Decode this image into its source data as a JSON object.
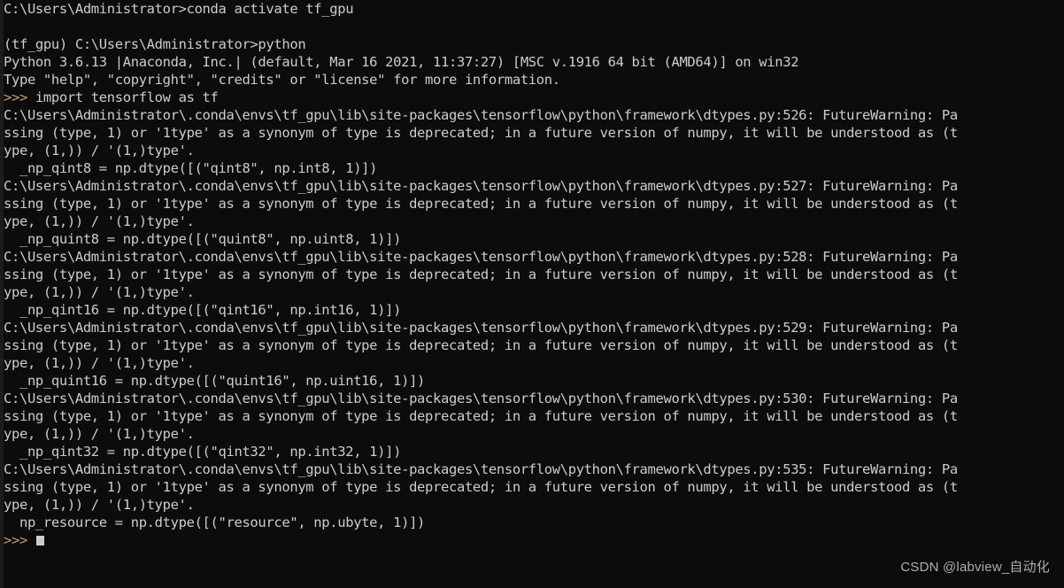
{
  "terminal": {
    "background_color": "#0c0c0c",
    "foreground_color": "#cccccc",
    "prompt_color": "#c2a25b",
    "lines": [
      "C:\\Users\\Administrator>conda activate tf_gpu",
      "",
      "(tf_gpu) C:\\Users\\Administrator>python",
      "Python 3.6.13 |Anaconda, Inc.| (default, Mar 16 2021, 11:37:27) [MSC v.1916 64 bit (AMD64)] on win32",
      "Type \"help\", \"copyright\", \"credits\" or \"license\" for more information.",
      ">>> import tensorflow as tf",
      "C:\\Users\\Administrator\\.conda\\envs\\tf_gpu\\lib\\site-packages\\tensorflow\\python\\framework\\dtypes.py:526: FutureWarning: Pa",
      "ssing (type, 1) or '1type' as a synonym of type is deprecated; in a future version of numpy, it will be understood as (t",
      "ype, (1,)) / '(1,)type'.",
      "  _np_qint8 = np.dtype([(\"qint8\", np.int8, 1)])",
      "C:\\Users\\Administrator\\.conda\\envs\\tf_gpu\\lib\\site-packages\\tensorflow\\python\\framework\\dtypes.py:527: FutureWarning: Pa",
      "ssing (type, 1) or '1type' as a synonym of type is deprecated; in a future version of numpy, it will be understood as (t",
      "ype, (1,)) / '(1,)type'.",
      "  _np_quint8 = np.dtype([(\"quint8\", np.uint8, 1)])",
      "C:\\Users\\Administrator\\.conda\\envs\\tf_gpu\\lib\\site-packages\\tensorflow\\python\\framework\\dtypes.py:528: FutureWarning: Pa",
      "ssing (type, 1) or '1type' as a synonym of type is deprecated; in a future version of numpy, it will be understood as (t",
      "ype, (1,)) / '(1,)type'.",
      "  _np_qint16 = np.dtype([(\"qint16\", np.int16, 1)])",
      "C:\\Users\\Administrator\\.conda\\envs\\tf_gpu\\lib\\site-packages\\tensorflow\\python\\framework\\dtypes.py:529: FutureWarning: Pa",
      "ssing (type, 1) or '1type' as a synonym of type is deprecated; in a future version of numpy, it will be understood as (t",
      "ype, (1,)) / '(1,)type'.",
      "  _np_quint16 = np.dtype([(\"quint16\", np.uint16, 1)])",
      "C:\\Users\\Administrator\\.conda\\envs\\tf_gpu\\lib\\site-packages\\tensorflow\\python\\framework\\dtypes.py:530: FutureWarning: Pa",
      "ssing (type, 1) or '1type' as a synonym of type is deprecated; in a future version of numpy, it will be understood as (t",
      "ype, (1,)) / '(1,)type'.",
      "  _np_qint32 = np.dtype([(\"qint32\", np.int32, 1)])",
      "C:\\Users\\Administrator\\.conda\\envs\\tf_gpu\\lib\\site-packages\\tensorflow\\python\\framework\\dtypes.py:535: FutureWarning: Pa",
      "ssing (type, 1) or '1type' as a synonym of type is deprecated; in a future version of numpy, it will be understood as (t",
      "ype, (1,)) / '(1,)type'.",
      "  np_resource = np.dtype([(\"resource\", np.ubyte, 1)])"
    ],
    "final_prompt": ">>>",
    "cursor": "block-cursor"
  },
  "watermark": {
    "text": "CSDN @labview_自动化"
  }
}
